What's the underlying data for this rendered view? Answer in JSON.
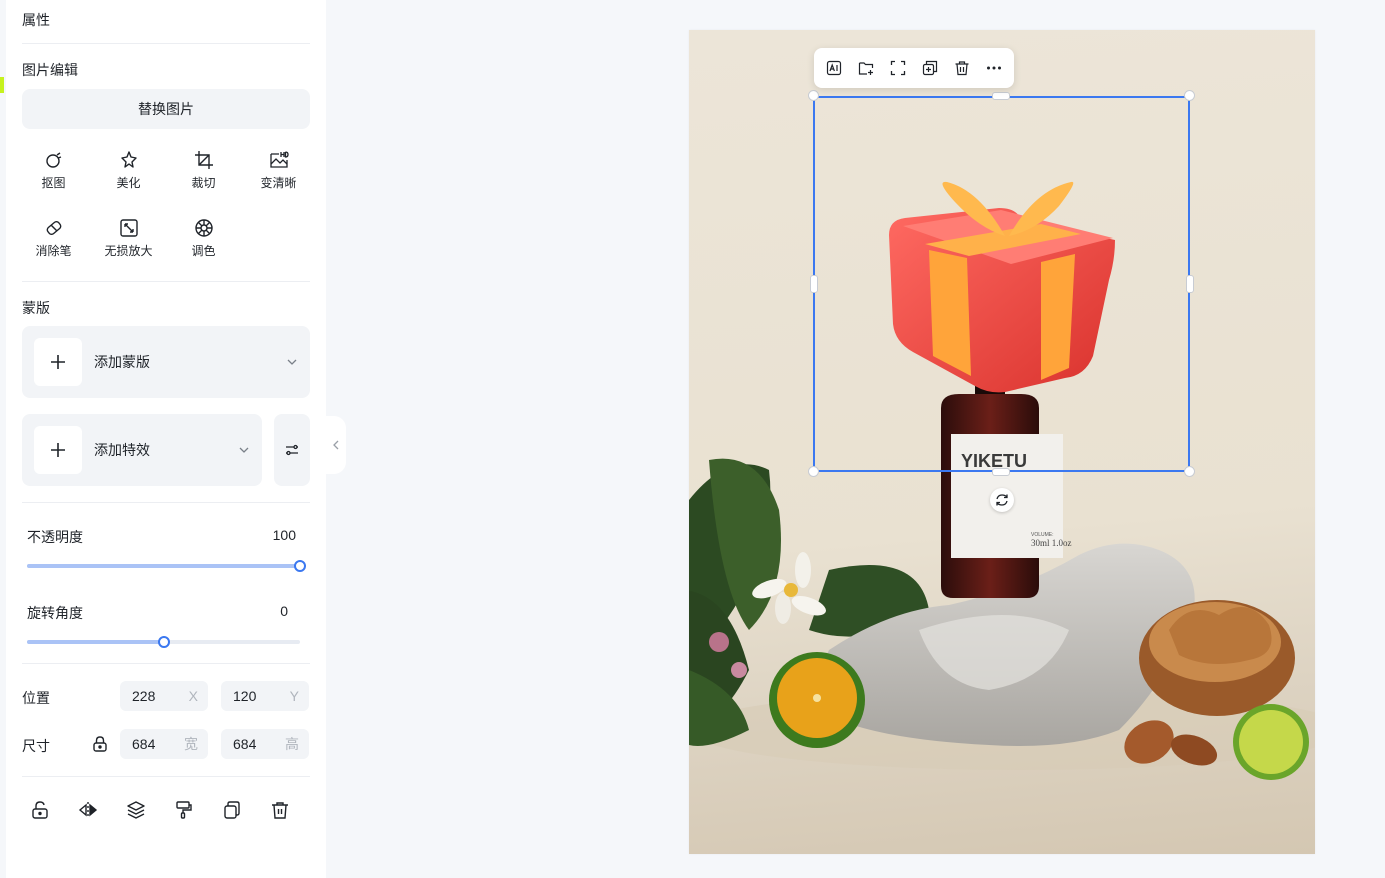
{
  "panel": {
    "title": "属性",
    "image_edit": {
      "heading": "图片编辑",
      "replace_label": "替换图片",
      "tools": [
        {
          "label": "抠图",
          "icon": "cutout-icon"
        },
        {
          "label": "美化",
          "icon": "beautify-icon"
        },
        {
          "label": "裁切",
          "icon": "crop-icon"
        },
        {
          "label": "变清晰",
          "icon": "hd-icon"
        },
        {
          "label": "消除笔",
          "icon": "eraser-icon"
        },
        {
          "label": "无损放大",
          "icon": "upscale-icon"
        },
        {
          "label": "调色",
          "icon": "color-adjust-icon"
        }
      ]
    },
    "mask": {
      "heading": "蒙版",
      "add_mask_label": "添加蒙版",
      "add_effect_label": "添加特效"
    },
    "opacity": {
      "label": "不透明度",
      "value": "100",
      "fraction": 1.0
    },
    "rotation": {
      "label": "旋转角度",
      "value": "0",
      "fraction": 0.5
    },
    "position": {
      "label": "位置",
      "x": "228",
      "x_unit": "X",
      "y": "120",
      "y_unit": "Y"
    },
    "size": {
      "label": "尺寸",
      "w": "684",
      "w_unit": "宽",
      "h": "684",
      "h_unit": "高",
      "locked": false
    },
    "bottom_actions": [
      "unlock-icon",
      "flip-icon",
      "layers-icon",
      "format-painter-icon",
      "copy-icon",
      "trash-icon"
    ]
  },
  "canvas": {
    "product_label": "YIKETU",
    "volume_label": "VOLUME:",
    "volume_value": "30ml 1.0oz"
  },
  "floating_toolbar": [
    "ai-icon",
    "add-folder-icon",
    "fullscreen-icon",
    "duplicate-icon",
    "trash-icon",
    "more-icon"
  ]
}
